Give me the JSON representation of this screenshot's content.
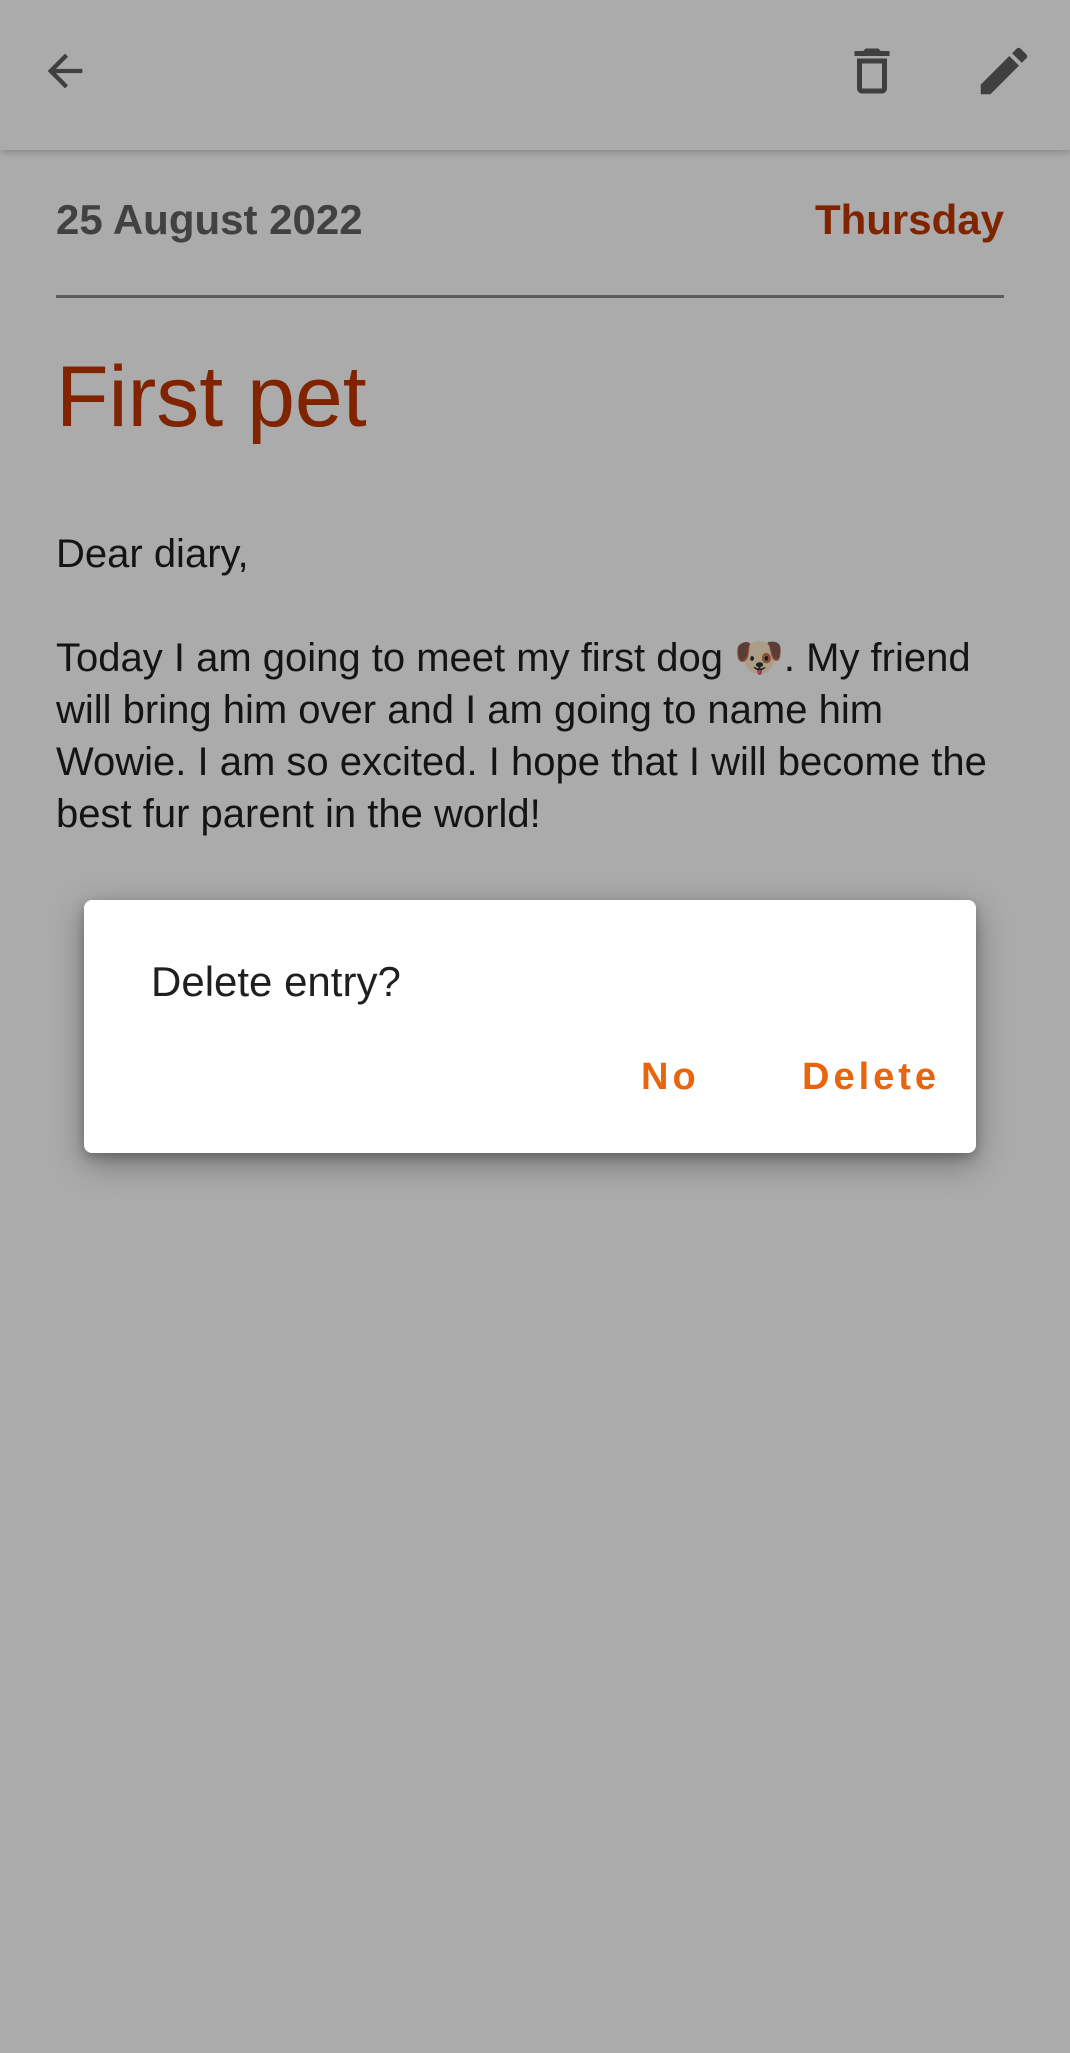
{
  "toolbar": {
    "back_icon": "arrow-left-icon",
    "delete_icon": "trash-icon",
    "edit_icon": "pencil-icon"
  },
  "entry": {
    "date": "25 August 2022",
    "day": "Thursday",
    "title": "First pet",
    "body": "Dear diary,\n\nToday I am going to meet my first dog 🐶. My friend will bring him over and I am going to name him Wowie. I am so excited. I hope that I will become the best fur parent in the world!"
  },
  "dialog": {
    "title": "Delete entry?",
    "no_label": "No",
    "delete_label": "Delete"
  },
  "colors": {
    "accent": "#bf3600",
    "dialog_button": "#e8650e",
    "date_text": "#616161"
  }
}
